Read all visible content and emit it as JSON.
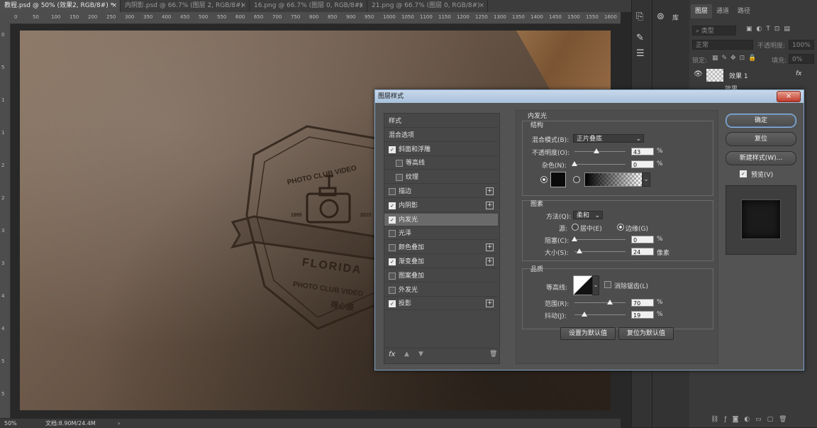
{
  "tabs": [
    {
      "label": "教程.psd @ 50% (效果2, RGB/8#) *",
      "active": true
    },
    {
      "label": "内阴影.psd @ 66.7% (图层 2, RGB/8#)",
      "active": false
    },
    {
      "label": "16.png @ 66.7% (图层 0, RGB/8#)",
      "active": false
    },
    {
      "label": "21.png @ 66.7% (图层 0, RGB/8#)",
      "active": false
    }
  ],
  "close_glyph": "×",
  "ruler_h": [
    "0",
    "50",
    "100",
    "150",
    "200",
    "250",
    "300",
    "350",
    "400",
    "450",
    "500",
    "550",
    "600",
    "650",
    "700",
    "750",
    "800",
    "850",
    "900",
    "950",
    "1000",
    "1050",
    "1100",
    "1150",
    "1200",
    "1250",
    "1300",
    "1350",
    "1400",
    "1450",
    "1500",
    "1550",
    "1600"
  ],
  "ruler_v": [
    "0",
    "5",
    "1",
    "1",
    "2",
    "2",
    "3",
    "3",
    "4",
    "4",
    "5",
    "5"
  ],
  "badge": {
    "top_text": "PHOTO CLUB VIDEO",
    "year_left": "1995",
    "year_right": "2015",
    "name": "FLORIDA",
    "subtitle": "PHOTO CLUB VIDEO",
    "cn": "得心摄"
  },
  "status": {
    "zoom": "50%",
    "doc": "文档:8.90M/24.4M",
    "arrow": "›"
  },
  "right_strip": {
    "library_label": "库"
  },
  "layers_panel": {
    "tabs": [
      "图层",
      "通道",
      "路径"
    ],
    "filter_placeholder": "类型",
    "blend_mode": "正常",
    "opacity_label": "不透明度:",
    "opacity_value": "100%",
    "lock_label": "锁定:",
    "fill_label": "填充:",
    "fill_value": "0%",
    "layer_name": "效果 1",
    "effect_label": "效果",
    "fx_label": "fx"
  },
  "dialog": {
    "title": "图层样式",
    "close": "×",
    "styles": [
      {
        "label": "样式",
        "checkbox": false,
        "checked": false,
        "plus": false,
        "indent": false,
        "selected": false
      },
      {
        "label": "混合选项",
        "checkbox": false,
        "checked": false,
        "plus": false,
        "indent": false,
        "selected": false
      },
      {
        "label": "斜面和浮雕",
        "checkbox": true,
        "checked": true,
        "plus": false,
        "indent": false,
        "selected": false
      },
      {
        "label": "等高线",
        "checkbox": true,
        "checked": false,
        "plus": false,
        "indent": true,
        "selected": false
      },
      {
        "label": "纹理",
        "checkbox": true,
        "checked": false,
        "plus": false,
        "indent": true,
        "selected": false
      },
      {
        "label": "描边",
        "checkbox": true,
        "checked": false,
        "plus": true,
        "indent": false,
        "selected": false
      },
      {
        "label": "内阴影",
        "checkbox": true,
        "checked": true,
        "plus": true,
        "indent": false,
        "selected": false
      },
      {
        "label": "内发光",
        "checkbox": true,
        "checked": true,
        "plus": false,
        "indent": false,
        "selected": true
      },
      {
        "label": "光泽",
        "checkbox": true,
        "checked": false,
        "plus": false,
        "indent": false,
        "selected": false
      },
      {
        "label": "颜色叠加",
        "checkbox": true,
        "checked": false,
        "plus": true,
        "indent": false,
        "selected": false
      },
      {
        "label": "渐变叠加",
        "checkbox": true,
        "checked": true,
        "plus": true,
        "indent": false,
        "selected": false
      },
      {
        "label": "图案叠加",
        "checkbox": true,
        "checked": false,
        "plus": false,
        "indent": false,
        "selected": false
      },
      {
        "label": "外发光",
        "checkbox": true,
        "checked": false,
        "plus": false,
        "indent": false,
        "selected": false
      },
      {
        "label": "投影",
        "checkbox": true,
        "checked": true,
        "plus": true,
        "indent": false,
        "selected": false
      }
    ],
    "fx": "fx",
    "inner_glow": {
      "title": "内发光",
      "structure": "结构",
      "blend_mode_label": "混合模式(B):",
      "blend_mode_value": "正片叠底",
      "opacity_label": "不透明度(O):",
      "opacity_value": "43",
      "opacity_fraction": 0.43,
      "noise_label": "杂色(N):",
      "noise_value": "0",
      "noise_fraction": 0.0,
      "elements": "图素",
      "method_label": "方法(Q):",
      "method_value": "柔和",
      "source_label": "源:",
      "center_label": "居中(E)",
      "edge_label": "边缘(G)",
      "choke_label": "阻塞(C):",
      "choke_value": "0",
      "choke_fraction": 0.0,
      "size_label": "大小(S):",
      "size_value": "24",
      "size_fraction": 0.1,
      "size_unit": "像素",
      "quality": "品质",
      "contour_label": "等高线:",
      "antialias_label": "消除锯齿(L)",
      "range_label": "范围(R):",
      "range_value": "70",
      "range_fraction": 0.7,
      "jitter_label": "抖动(J):",
      "jitter_value": "19",
      "jitter_fraction": 0.19,
      "percent": "%",
      "set_default": "设置为默认值",
      "reset_default": "复位为默认值"
    },
    "buttons": {
      "ok": "确定",
      "reset": "复位",
      "new_style": "新建样式(W)...",
      "preview": "预览(V)"
    }
  }
}
